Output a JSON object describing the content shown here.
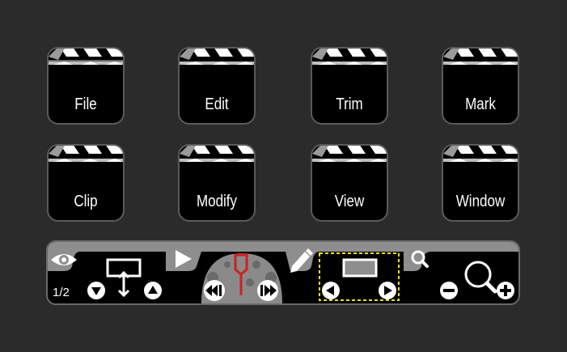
{
  "tiles": [
    {
      "label": "File"
    },
    {
      "label": "Edit"
    },
    {
      "label": "Trim"
    },
    {
      "label": "Mark"
    },
    {
      "label": "Clip"
    },
    {
      "label": "Modify"
    },
    {
      "label": "View"
    },
    {
      "label": "Window"
    }
  ],
  "toolbar": {
    "page_indicator": "1/2",
    "icons": [
      "eye-icon",
      "play-icon",
      "pencil-icon",
      "magnifier-icon"
    ]
  },
  "colors": {
    "background": "#2b2b2b",
    "tile": "#000000",
    "tab": "#8e8e8e",
    "playhead": "#d02020",
    "selection_dash": "#f2e20c"
  }
}
